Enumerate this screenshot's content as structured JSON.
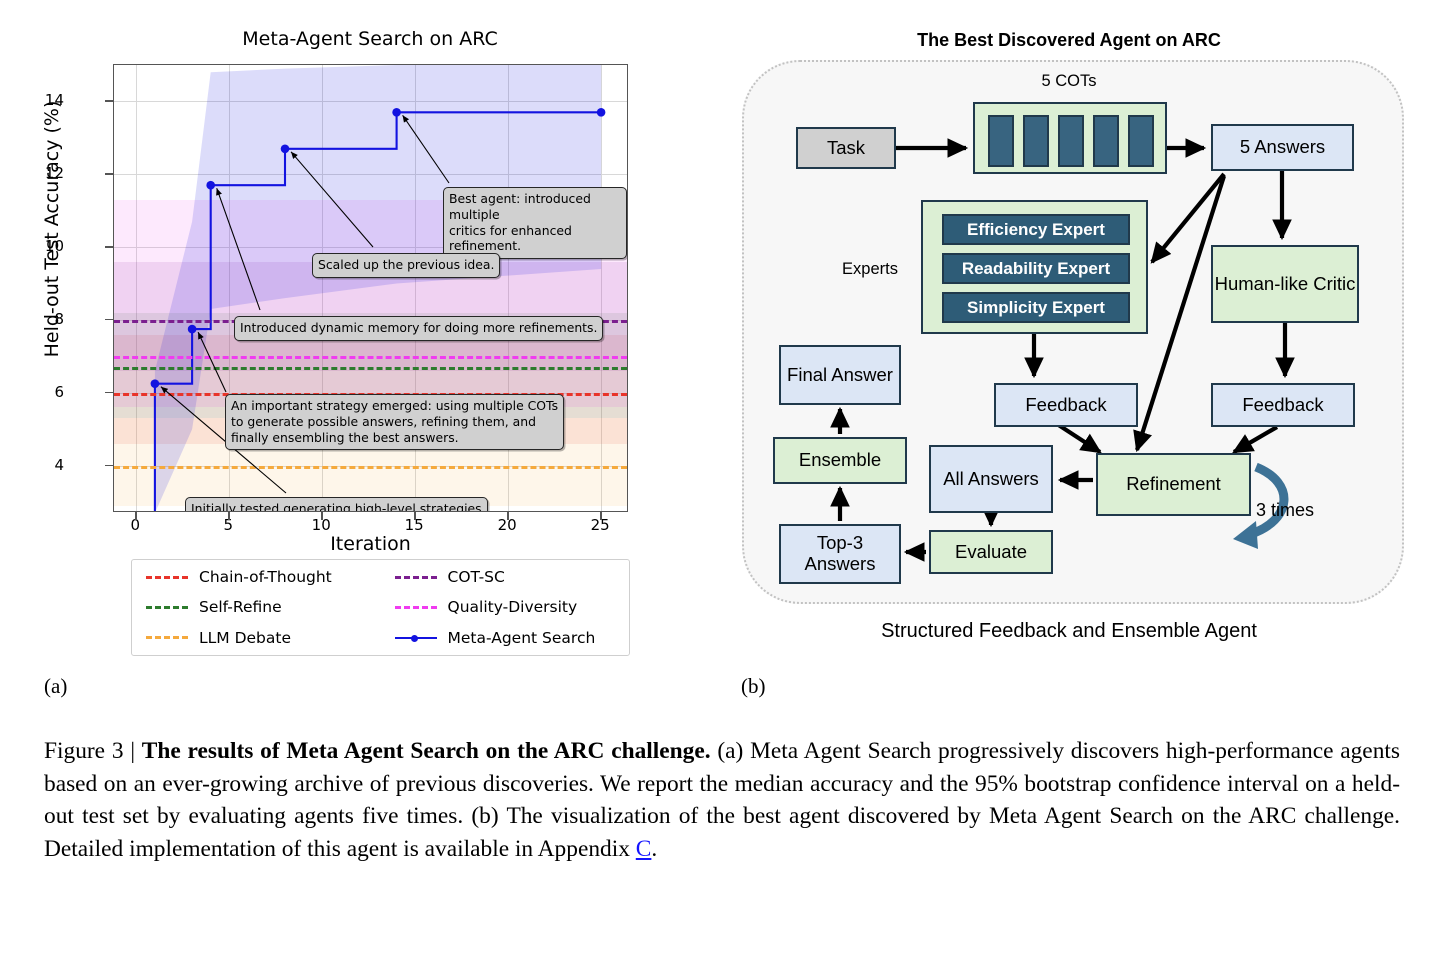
{
  "panel_a": {
    "sublabel": "(a)",
    "chart_data": {
      "type": "line",
      "title": "Meta-Agent Search on ARC",
      "xlabel": "Iteration",
      "ylabel": "Held-out Test Accuracy (%)",
      "xlim": [
        -1.2,
        26.5
      ],
      "ylim": [
        2.7,
        15.0
      ],
      "xticks": [
        "0",
        "5",
        "10",
        "15",
        "20",
        "25"
      ],
      "xtick_values": [
        0,
        5,
        10,
        15,
        20,
        25
      ],
      "yticks": [
        "4",
        "6",
        "8",
        "10",
        "12",
        "14"
      ],
      "ytick_values": [
        4,
        6,
        8,
        10,
        12,
        14
      ],
      "grid": true,
      "legend_position": "below-axes",
      "series": [
        {
          "name": "Chain-of-Thought",
          "kind": "hline",
          "value": 6.0,
          "color": "#e8342a",
          "style": "dashed",
          "band": [
            4.6,
            7.6
          ],
          "band_color": "#e8342a"
        },
        {
          "name": "Self-Refine",
          "kind": "hline",
          "value": 6.7,
          "color": "#2d7b2d",
          "style": "dashed",
          "band": [
            5.3,
            8.2
          ],
          "band_color": "#2d7b2d"
        },
        {
          "name": "LLM Debate",
          "kind": "hline",
          "value": 4.0,
          "color": "#f5a93c",
          "style": "dashed",
          "band": [
            2.9,
            5.3
          ],
          "band_color": "#f5a93c"
        },
        {
          "name": "COT-SC",
          "kind": "hline",
          "value": 8.0,
          "color": "#7b1f8f",
          "style": "dashed",
          "band": [
            6.6,
            9.6
          ],
          "band_color": "#7b1f8f"
        },
        {
          "name": "Quality-Diversity",
          "kind": "hline",
          "value": 7.0,
          "color": "#f03bf0",
          "style": "dashed",
          "band": [
            5.6,
            11.3
          ],
          "band_color": "#f03bf0"
        },
        {
          "name": "Meta-Agent Search",
          "kind": "step",
          "color": "#1313e0",
          "style": "solid",
          "marker": "circle",
          "x": [
            1,
            3,
            4,
            8,
            14,
            25
          ],
          "y": [
            6.25,
            7.75,
            11.7,
            12.7,
            13.7,
            13.7
          ],
          "band_low": [
            2.7,
            5.0,
            8.3,
            8.6,
            9.0,
            9.4
          ],
          "band_high": [
            6.6,
            10.7,
            14.8,
            14.9,
            15.0,
            15.0
          ]
        }
      ],
      "annotations": [
        {
          "id": "annot-best-agent",
          "text": "Best agent: introduced multiple\ncritics for enhanced refinement.",
          "target_x": 14,
          "target_y": 13.7
        },
        {
          "id": "annot-scaled-up",
          "text": "Scaled up the previous idea.",
          "target_x": 8,
          "target_y": 12.7
        },
        {
          "id": "annot-dynamic-memory",
          "text": "Introduced dynamic memory for doing more refinements.",
          "target_x": 4,
          "target_y": 11.7
        },
        {
          "id": "annot-multiple-cots",
          "text": "An important strategy emerged: using multiple COTs\nto generate possible answers, refining them, and\nfinally ensembling the best answers.",
          "target_x": 3,
          "target_y": 7.75
        },
        {
          "id": "annot-initially-tested",
          "text": "Initially tested generating high-level strategies\nbefore implementing low-level details.",
          "target_x": 1,
          "target_y": 6.25
        }
      ]
    }
  },
  "panel_b": {
    "sublabel": "(b)",
    "title": "The Best Discovered Agent on ARC",
    "caption": "Structured Feedback and Ensemble Agent",
    "labels": {
      "cots_header": "5 COTs",
      "experts_header": "Experts",
      "loop_count": "3 times"
    },
    "nodes": [
      {
        "id": "task",
        "label": "Task",
        "style": "gray"
      },
      {
        "id": "cots-group",
        "label": "",
        "style": "green"
      },
      {
        "id": "five-answers",
        "label": "5 Answers",
        "style": "blue"
      },
      {
        "id": "experts-group",
        "label": "",
        "style": "green"
      },
      {
        "id": "human-critic",
        "label": "Human-like\nCritic",
        "style": "green"
      },
      {
        "id": "feedback-left",
        "label": "Feedback",
        "style": "blue"
      },
      {
        "id": "feedback-right",
        "label": "Feedback",
        "style": "blue"
      },
      {
        "id": "refinement",
        "label": "Refinement",
        "style": "green"
      },
      {
        "id": "all-answers",
        "label": "All\nAnswers",
        "style": "blue"
      },
      {
        "id": "evaluate",
        "label": "Evaluate",
        "style": "green"
      },
      {
        "id": "top3-answers",
        "label": "Top-3\nAnswers",
        "style": "blue"
      },
      {
        "id": "ensemble",
        "label": "Ensemble",
        "style": "green"
      },
      {
        "id": "final-answer",
        "label": "Final\nAnswer",
        "style": "blue"
      }
    ],
    "experts": [
      "Efficiency Expert",
      "Readability Expert",
      "Simplicity Expert"
    ],
    "colors": {
      "blue_fill": "#dce6f5",
      "green_fill": "#dcefd4",
      "gray_fill": "#d0d0d0",
      "border": "#20394b",
      "expert_fill": "#2e5c77",
      "cot_bar": "#386480",
      "loop_arrow": "#3d7296"
    }
  },
  "figure_caption": {
    "prefix": "Figure 3 | ",
    "bold": "The results of Meta Agent Search on the ARC challenge.",
    "body": " (a) Meta Agent Search progressively discovers high-performance agents based on an ever-growing archive of previous discoveries. We report the median accuracy and the 95% bootstrap confidence interval on a held-out test set by evaluating agents five times. (b) The visualization of the best agent discovered by Meta Agent Search on the ARC challenge. Detailed implementation of this agent is available in Appendix ",
    "link": "C",
    "suffix": "."
  }
}
